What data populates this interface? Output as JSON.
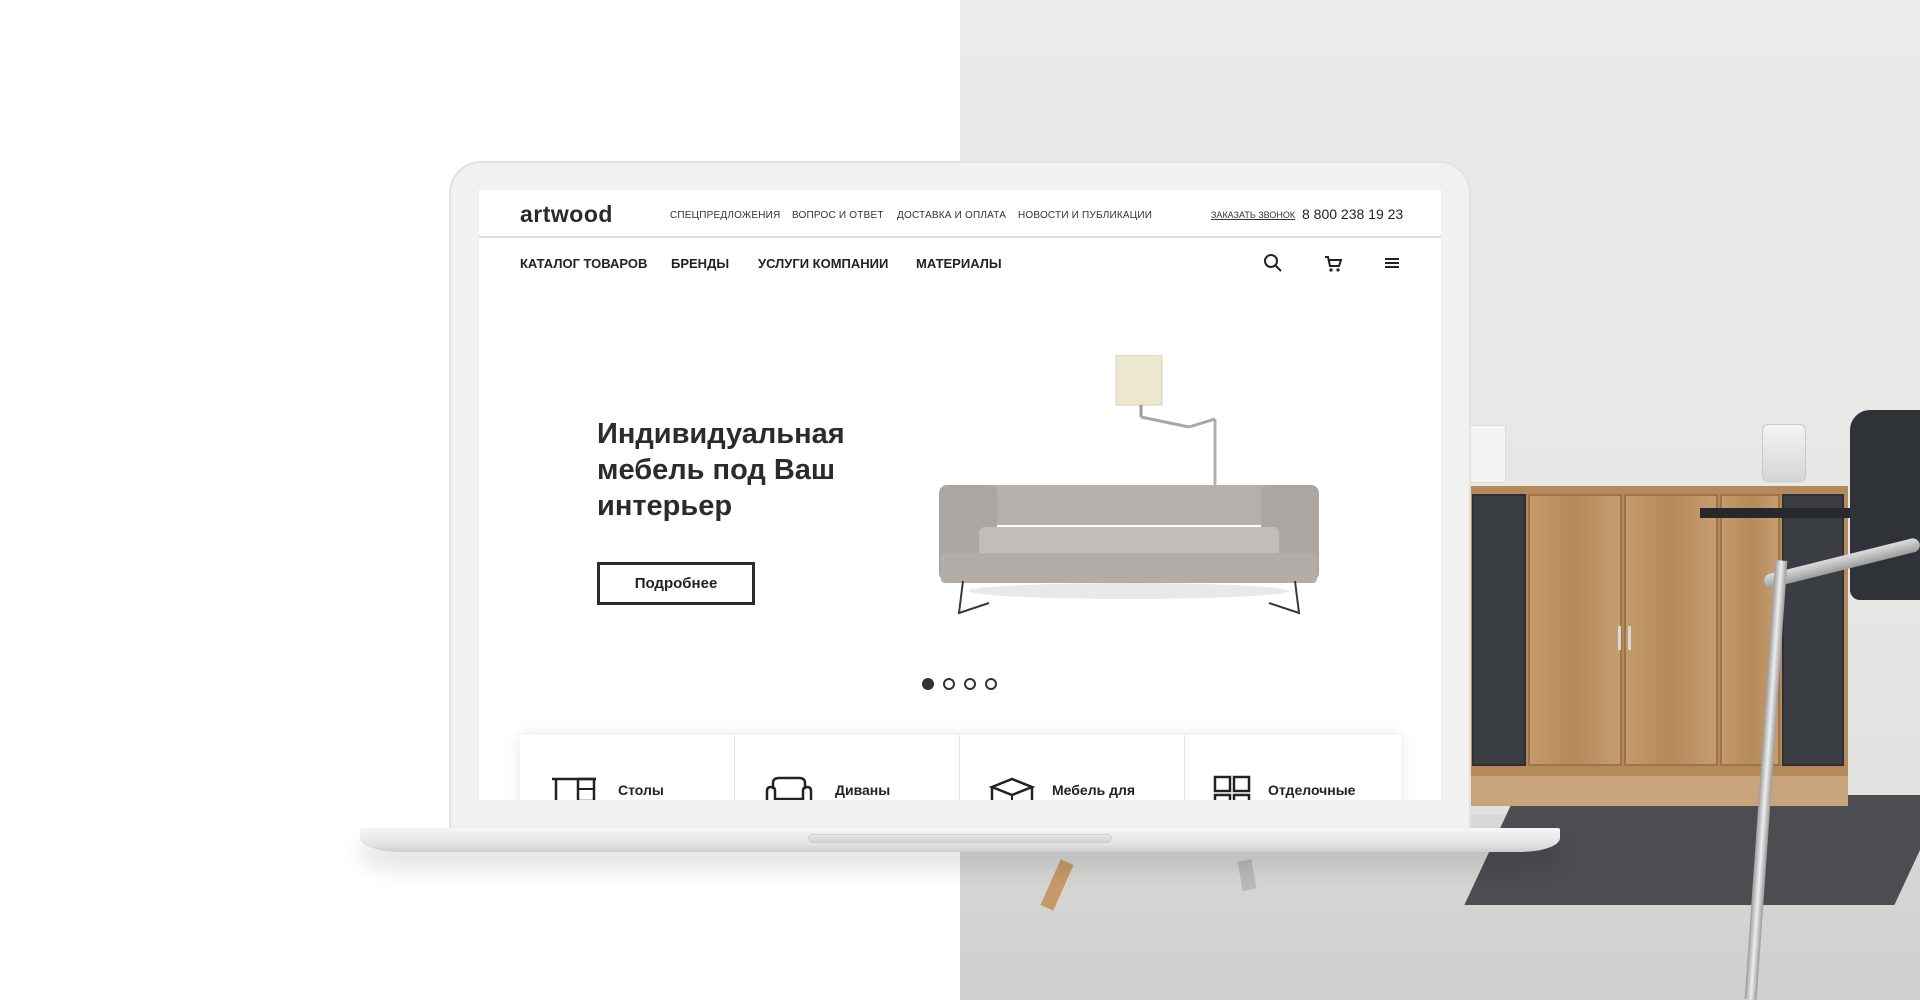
{
  "site": {
    "logo": "artwood",
    "top_links": [
      "СПЕЦПРЕДЛОЖЕНИЯ",
      "ВОПРОС И ОТВЕТ",
      "ДОСТАВКА И ОПЛАТА",
      "НОВОСТИ И ПУБЛИКАЦИИ"
    ],
    "callback_label": "ЗАКАЗАТЬ ЗВОНОК",
    "phone": "8 800 238 19 23"
  },
  "main_nav": [
    "КАТАЛОГ ТОВАРОВ",
    "БРЕНДЫ",
    "УСЛУГИ КОМПАНИИ",
    "МАТЕРИАЛЫ"
  ],
  "nav_icons": [
    "search-icon",
    "cart-icon",
    "menu-icon"
  ],
  "hero": {
    "title": "Индивидуальная мебель под Ваш интерьер",
    "button_label": "Подробнее",
    "slides_total": 4,
    "active_slide": 1
  },
  "categories": [
    {
      "label": "Столы",
      "icon": "desk-icon"
    },
    {
      "label": "Диваны",
      "icon": "sofa-icon"
    },
    {
      "label": "Мебель для",
      "icon": "storage-box-icon"
    },
    {
      "label": "Отделочные",
      "icon": "tiles-icon"
    }
  ],
  "colors": {
    "text": "#2b2b2b",
    "background_left": "#ffffff",
    "laptop_body": "#f1f1f1",
    "sofa": "#b8b2ae",
    "cabinet_wood": "#b48a5c",
    "cabinet_dark": "#3a3d42"
  }
}
